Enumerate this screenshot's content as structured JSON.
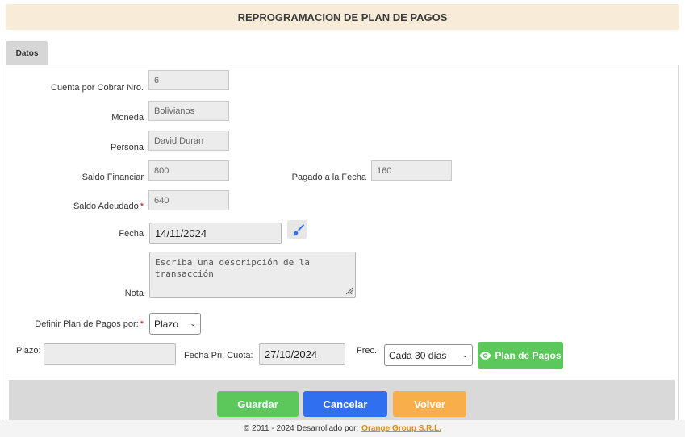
{
  "header": {
    "title": "REPROGRAMACION DE PLAN DE PAGOS"
  },
  "tabs": [
    {
      "label": "Datos"
    }
  ],
  "form": {
    "cuenta": {
      "label": "Cuenta por Cobrar Nro.",
      "value": "6"
    },
    "moneda": {
      "label": "Moneda",
      "value": "Bolivianos"
    },
    "persona": {
      "label": "Persona",
      "value": "David Duran"
    },
    "saldo_financiar": {
      "label": "Saldo Financiar",
      "value": "800"
    },
    "pagado": {
      "label": "Pagado a la Fecha",
      "value": "160"
    },
    "saldo_adeudado": {
      "label": "Saldo Adeudado",
      "required": "*",
      "value": "640"
    },
    "fecha": {
      "label": "Fecha",
      "value": "14/11/2024"
    },
    "nota": {
      "label": "Nota",
      "placeholder": "Escriba una descripción de la transacción"
    },
    "definir": {
      "label": "Definir Plan de Pagos por:",
      "required": "*",
      "value": "Plazo"
    },
    "plazo": {
      "label": "Plazo:",
      "value": ""
    },
    "fecha_pri": {
      "label": "Fecha Pri. Cuota:",
      "value": "27/10/2024"
    },
    "frec": {
      "label": "Frec.:",
      "value": "Cada 30 días"
    },
    "plan_button": "Plan de Pagos"
  },
  "actions": {
    "guardar": "Guardar",
    "cancelar": "Cancelar",
    "volver": "Volver"
  },
  "footer": {
    "text": "© 2011 - 2024 Desarrollado por:",
    "link": "Orange Group S.R.L."
  },
  "colors": {
    "green": "#5cc85c",
    "blue": "#2f6ff0",
    "orange": "#f9ae4c",
    "accent_link": "#e48a0a"
  },
  "icons": {
    "brush": "paint-brush-icon",
    "eye": "eye-icon"
  }
}
